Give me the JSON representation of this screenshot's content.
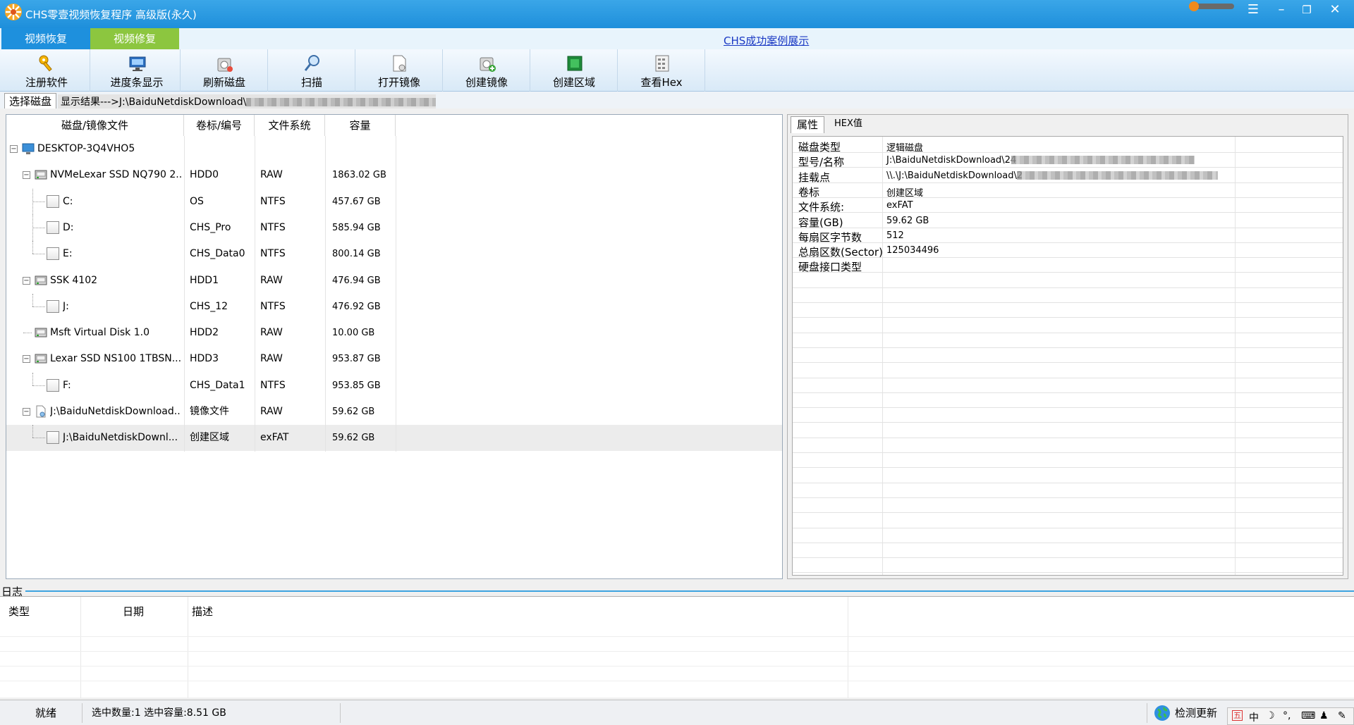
{
  "window": {
    "title": "CHS零壹视频恢复程序 高级版(永久)",
    "accent": "#1e8fdb",
    "controls": [
      "menu-icon",
      "minimize-icon",
      "restore-icon",
      "close-icon"
    ]
  },
  "nav": {
    "tabs": [
      {
        "label": "视频恢复",
        "color": "#1e90dd"
      },
      {
        "label": "视频修复",
        "color": "#8cc63f"
      }
    ],
    "link": "CHS成功案例展示"
  },
  "toolbar": {
    "items": [
      {
        "label": "注册软件",
        "icon": "key-icon"
      },
      {
        "label": "进度条显示",
        "icon": "monitor-icon"
      },
      {
        "label": "刷新磁盘",
        "icon": "refresh-disk-icon"
      },
      {
        "label": "扫描",
        "icon": "magnifier-icon"
      },
      {
        "label": "打开镜像",
        "icon": "open-image-icon"
      },
      {
        "label": "创建镜像",
        "icon": "create-image-icon"
      },
      {
        "label": "创建区域",
        "icon": "create-region-icon"
      },
      {
        "label": "查看Hex",
        "icon": "hex-icon"
      }
    ]
  },
  "selector": {
    "tab": "选择磁盘",
    "result_prefix": "显示结果--->J:\\BaiduNetdiskDownload\\"
  },
  "disk_table": {
    "columns": [
      "磁盘/镜像文件",
      "卷标/编号",
      "文件系统",
      "容量"
    ],
    "rows": [
      {
        "name": "DESKTOP-3Q4VHO5",
        "label": "",
        "fs": "",
        "size": "",
        "level": 0,
        "kind": "computer"
      },
      {
        "name": "NVMeLexar SSD NQ790 2...",
        "label": "HDD0",
        "fs": "RAW",
        "size": "1863.02 GB",
        "level": 1,
        "kind": "disk"
      },
      {
        "name": "C:",
        "label": "OS",
        "fs": "NTFS",
        "size": "457.67 GB",
        "level": 2,
        "kind": "partition"
      },
      {
        "name": "D:",
        "label": "CHS_Pro",
        "fs": "NTFS",
        "size": "585.94 GB",
        "level": 2,
        "kind": "partition"
      },
      {
        "name": "E:",
        "label": "CHS_Data0",
        "fs": "NTFS",
        "size": "800.14 GB",
        "level": 2,
        "kind": "partition"
      },
      {
        "name": "SSK              4102",
        "label": "HDD1",
        "fs": "RAW",
        "size": "476.94 GB",
        "level": 1,
        "kind": "disk"
      },
      {
        "name": "J:",
        "label": "CHS_12",
        "fs": "NTFS",
        "size": "476.92 GB",
        "level": 2,
        "kind": "partition"
      },
      {
        "name": "Msft    Virtual Disk    1.0",
        "label": "HDD2",
        "fs": "RAW",
        "size": "10.00 GB",
        "level": 1,
        "kind": "disk"
      },
      {
        "name": "Lexar SSD NS100 1TBSN...",
        "label": "HDD3",
        "fs": "RAW",
        "size": "953.87 GB",
        "level": 1,
        "kind": "disk"
      },
      {
        "name": "F:",
        "label": "CHS_Data1",
        "fs": "NTFS",
        "size": "953.85 GB",
        "level": 2,
        "kind": "partition"
      },
      {
        "name": "J:\\BaiduNetdiskDownload...",
        "label": "镜像文件",
        "fs": "RAW",
        "size": "59.62 GB",
        "level": 1,
        "kind": "image"
      },
      {
        "name": "J:\\BaiduNetdiskDownl...",
        "label": "创建区域",
        "fs": "exFAT",
        "size": "59.62 GB",
        "level": 2,
        "kind": "partition",
        "selected": true
      }
    ]
  },
  "properties": {
    "tabs": [
      "属性",
      "HEX值"
    ],
    "rows": [
      {
        "key": "磁盘类型",
        "value": "逻辑磁盘"
      },
      {
        "key": "型号/名称",
        "value": "J:\\BaiduNetdiskDownload\\24"
      },
      {
        "key": "挂载点",
        "value": "\\\\.\\J:\\BaiduNetdiskDownload\\2"
      },
      {
        "key": "卷标",
        "value": "创建区域"
      },
      {
        "key": "文件系统:",
        "value": "exFAT"
      },
      {
        "key": "容量(GB)",
        "value": "59.62 GB"
      },
      {
        "key": "每扇区字节数",
        "value": "512"
      },
      {
        "key": "总扇区数(Sector)",
        "value": "125034496"
      },
      {
        "key": "硬盘接口类型",
        "value": ""
      }
    ]
  },
  "log": {
    "title": "日志",
    "columns": [
      "类型",
      "日期",
      "描述"
    ]
  },
  "status": {
    "ready": "就绪",
    "selection": "选中数量:1 选中容量:8.51 GB",
    "update": "检测更新"
  },
  "ime": {
    "items": [
      "五",
      "中",
      "☽",
      "°,",
      "⌨",
      "♟",
      "✎"
    ]
  }
}
